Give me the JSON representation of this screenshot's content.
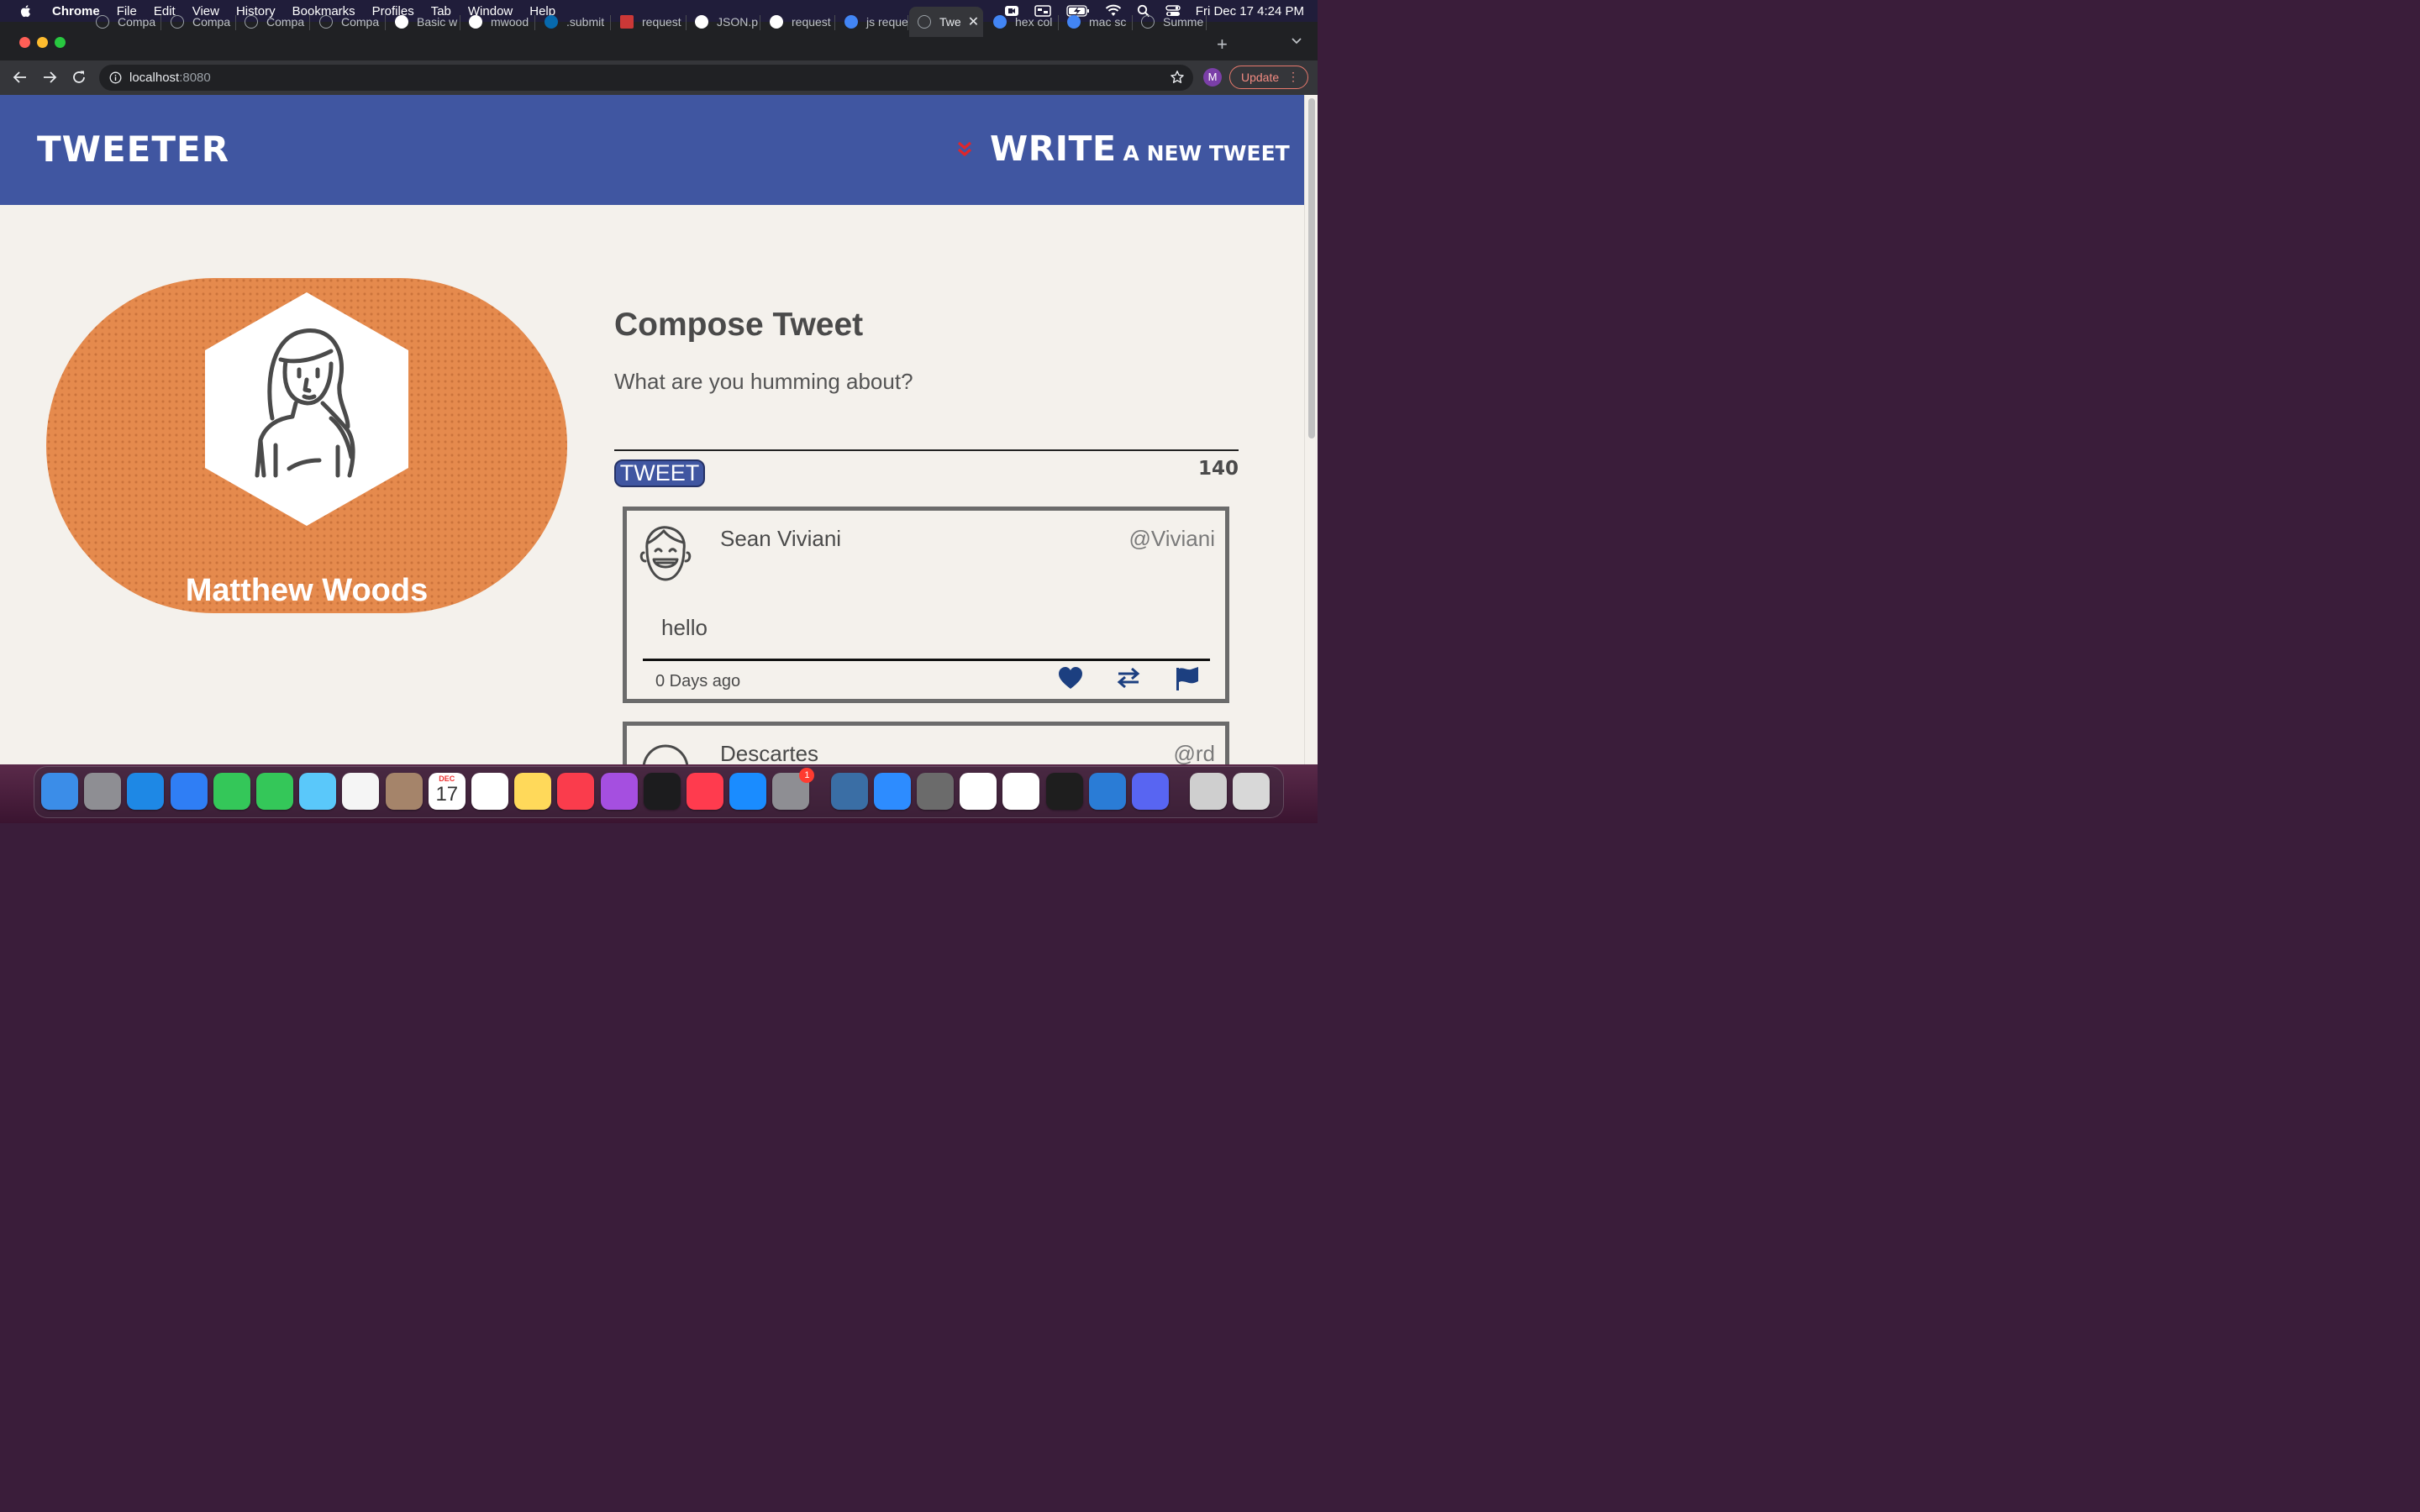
{
  "menubar": {
    "items": [
      "Chrome",
      "File",
      "Edit",
      "View",
      "History",
      "Bookmarks",
      "Profiles",
      "Tab",
      "Window",
      "Help"
    ],
    "clock": "Fri Dec 17  4:24 PM"
  },
  "browser": {
    "tabs": [
      {
        "title": "Compa",
        "favicon": "generic-icon"
      },
      {
        "title": "Compa",
        "favicon": "generic-icon"
      },
      {
        "title": "Compa",
        "favicon": "generic-icon"
      },
      {
        "title": "Compa",
        "favicon": "generic-icon"
      },
      {
        "title": "Basic w",
        "favicon": "github-icon"
      },
      {
        "title": "mwood",
        "favicon": "github-icon"
      },
      {
        "title": ".submit",
        "favicon": "jquery-icon"
      },
      {
        "title": "request",
        "favicon": "npm-icon"
      },
      {
        "title": "JSON.p",
        "favicon": "mdn-icon"
      },
      {
        "title": "request",
        "favicon": "github-icon"
      },
      {
        "title": "js reque",
        "favicon": "google-icon"
      },
      {
        "title": "Twe",
        "favicon": "globe-icon",
        "active": true
      },
      {
        "title": "hex col",
        "favicon": "google-icon"
      },
      {
        "title": "mac sc",
        "favicon": "google-icon"
      },
      {
        "title": "Summe",
        "favicon": "generic-icon"
      }
    ],
    "url_host": "localhost",
    "url_port": ":8080",
    "profile_initial": "M",
    "update_label": "Update"
  },
  "header": {
    "brand": "TWEETER",
    "write_big": "WRITE",
    "write_small": "A NEW TWEET",
    "chevron_color": "#e0262b",
    "bg_color": "#4056a1"
  },
  "profile": {
    "name": "Matthew Woods",
    "card_color": "#e58a4d"
  },
  "compose": {
    "title": "Compose Tweet",
    "placeholder": "What are you humming about?",
    "button_label": "TWEET",
    "counter": "140"
  },
  "tweets": [
    {
      "name": "Sean Viviani",
      "handle": "@Viviani",
      "body": "hello",
      "age": "0 Days ago",
      "avatar_icon": "laughing-man-icon"
    },
    {
      "name": "Descartes",
      "handle": "@rd",
      "body": "",
      "age": "",
      "avatar_icon": "man-avatar-icon"
    }
  ],
  "tweet_actions": [
    "heart-icon",
    "retweet-icon",
    "flag-icon"
  ],
  "dock": {
    "apps": [
      "Finder",
      "Launchpad",
      "Safari",
      "Mail",
      "FaceTime",
      "Messages",
      "Maps",
      "Photos",
      "Contacts",
      "Calendar",
      "Reminders",
      "Notes",
      "Music",
      "Podcasts",
      "TV",
      "News",
      "App Store",
      "System Preferences",
      "VirtualBox",
      "Zoom",
      "Keychain",
      "Slack",
      "Chrome",
      "Terminal",
      "VS Code",
      "Discord",
      "Downloads",
      "Trash"
    ],
    "calendar_month": "DEC",
    "calendar_day": "17",
    "prefs_badge": "1"
  }
}
